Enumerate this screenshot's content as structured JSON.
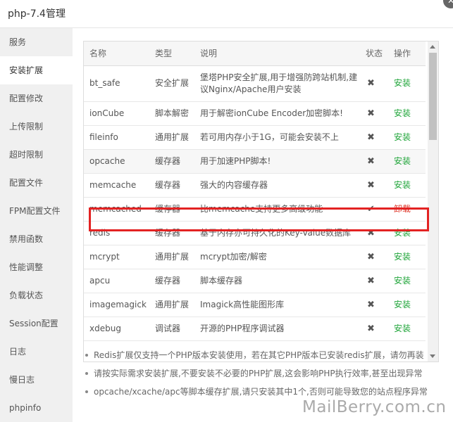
{
  "window": {
    "title": "php-7.4管理",
    "close_label": "✕"
  },
  "sidebar": {
    "items": [
      {
        "label": "服务",
        "active": false
      },
      {
        "label": "安装扩展",
        "active": true
      },
      {
        "label": "配置修改",
        "active": false
      },
      {
        "label": "上传限制",
        "active": false
      },
      {
        "label": "超时限制",
        "active": false
      },
      {
        "label": "配置文件",
        "active": false
      },
      {
        "label": "FPM配置文件",
        "active": false
      },
      {
        "label": "禁用函数",
        "active": false
      },
      {
        "label": "性能调整",
        "active": false
      },
      {
        "label": "负载状态",
        "active": false
      },
      {
        "label": "Session配置",
        "active": false
      },
      {
        "label": "日志",
        "active": false
      },
      {
        "label": "慢日志",
        "active": false
      },
      {
        "label": "phpinfo",
        "active": false
      }
    ]
  },
  "table": {
    "headers": {
      "name": "名称",
      "type": "类型",
      "desc": "说明",
      "status": "状态",
      "op": "操作"
    },
    "rows": [
      {
        "name": "bt_safe",
        "type": "安全扩展",
        "desc": "堡塔PHP安全扩展,用于增强防跨站机制,建议Nginx/Apache用户安装",
        "status": "✖",
        "op": "安装",
        "installed": false
      },
      {
        "name": "ionCube",
        "type": "脚本解密",
        "desc": "用于解密ionCube Encoder加密脚本!",
        "status": "✖",
        "op": "安装",
        "installed": false
      },
      {
        "name": "fileinfo",
        "type": "通用扩展",
        "desc": "若可用内存小于1G，可能会安装不上",
        "status": "✖",
        "op": "安装",
        "installed": false
      },
      {
        "name": "opcache",
        "type": "缓存器",
        "desc": "用于加速PHP脚本!",
        "status": "✖",
        "op": "安装",
        "installed": false
      },
      {
        "name": "memcache",
        "type": "缓存器",
        "desc": "强大的内容缓存器",
        "status": "✖",
        "op": "安装",
        "installed": false
      },
      {
        "name": "memcached",
        "type": "缓存器",
        "desc": "比memcache支持更多高级功能",
        "status": "✔",
        "op": "卸载",
        "installed": true
      },
      {
        "name": "redis",
        "type": "缓存器",
        "desc": "基于内存亦可持久化的Key-Value数据库",
        "status": "✖",
        "op": "安装",
        "installed": false
      },
      {
        "name": "mcrypt",
        "type": "通用扩展",
        "desc": "mcrypt加密/解密",
        "status": "✖",
        "op": "安装",
        "installed": false
      },
      {
        "name": "apcu",
        "type": "缓存器",
        "desc": "脚本缓存器",
        "status": "✖",
        "op": "安装",
        "installed": false
      },
      {
        "name": "imagemagick",
        "type": "通用扩展",
        "desc": "Imagick高性能图形库",
        "status": "✖",
        "op": "安装",
        "installed": false
      },
      {
        "name": "xdebug",
        "type": "调试器",
        "desc": "开源的PHP程序调试器",
        "status": "✖",
        "op": "安装",
        "installed": false
      }
    ]
  },
  "notes": [
    "Redis扩展仅支持一个PHP版本安装使用，若在其它PHP版本已安装redis扩展，请勿再装",
    "请按实际需求安装扩展,不要安装不必要的PHP扩展,这会影响PHP执行效率,甚至出现异常",
    "opcache/xcache/apc等脚本缓存扩展,请只安装其中1个,否则可能导致您的站点程序异常"
  ],
  "watermark": "MailBerry.com.cn",
  "colors": {
    "install": "#20a53a",
    "uninstall": "#e03b2f",
    "highlight": "#e32222"
  }
}
